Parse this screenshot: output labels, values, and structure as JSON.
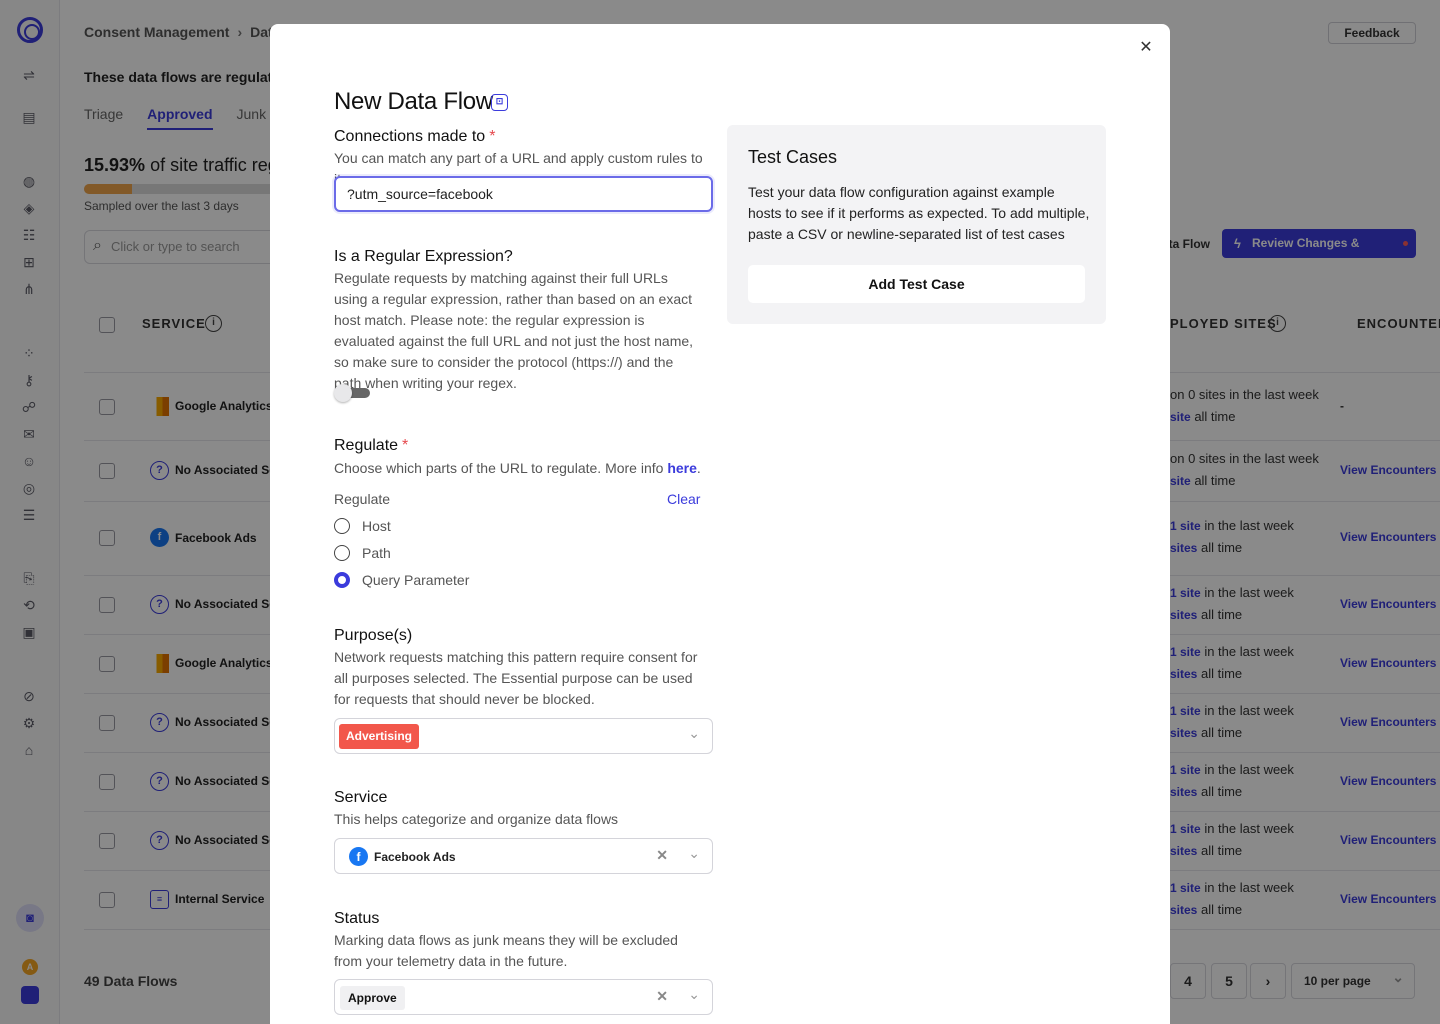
{
  "background": {
    "breadcrumb": [
      "Consent Management",
      "Data"
    ],
    "feedback_label": "Feedback",
    "regulated_note": "These data flows are regulated",
    "tabs": [
      "Triage",
      "Approved",
      "Junk"
    ],
    "traffic_pct": "15.93%",
    "traffic_text": "of site traffic regu",
    "sampled": "Sampled over the last 3 days",
    "search_placeholder": "Click or type to search",
    "new_flow_btn": "ta Flow",
    "review_btn": "Review Changes & Publish...",
    "col_service": "SERVICE",
    "col_deployed": "PLOYED SITES",
    "col_encounters": "ENCOUNTERS",
    "rows": [
      {
        "service": "Google Analytics",
        "icon": "google-analytics-icon",
        "dep1": "on 0 sites in the last week",
        "dep_link1": "",
        "dep2_link": "site",
        "dep2": "all time",
        "enc": "-"
      },
      {
        "service": "No Associated Ser",
        "icon": "question-icon",
        "dep1": "on 0 sites in the last week",
        "dep_link1": "",
        "dep2_link": "site",
        "dep2": "all time",
        "enc": "View Encounters"
      },
      {
        "service": "Facebook Ads",
        "icon": "facebook-icon",
        "dep1": "in the last week",
        "dep_link1": "1 site",
        "dep2_link": "sites",
        "dep2": "all time",
        "enc": "View Encounters"
      },
      {
        "service": "No Associated Ser",
        "icon": "question-icon",
        "dep1": "in the last week",
        "dep_link1": "1 site",
        "dep2_link": "sites",
        "dep2": "all time",
        "enc": "View Encounters"
      },
      {
        "service": "Google Analytics",
        "icon": "google-analytics-icon",
        "dep1": "in the last week",
        "dep_link1": "1 site",
        "dep2_link": "sites",
        "dep2": "all time",
        "enc": "View Encounters"
      },
      {
        "service": "No Associated Ser",
        "icon": "question-icon",
        "dep1": "in the last week",
        "dep_link1": "1 site",
        "dep2_link": "sites",
        "dep2": "all time",
        "enc": "View Encounters"
      },
      {
        "service": "No Associated Ser",
        "icon": "question-icon",
        "dep1": "in the last week",
        "dep_link1": "1 site",
        "dep2_link": "sites",
        "dep2": "all time",
        "enc": "View Encounters"
      },
      {
        "service": "No Associated Ser",
        "icon": "question-icon",
        "dep1": "in the last week",
        "dep_link1": "1 site",
        "dep2_link": "sites",
        "dep2": "all time",
        "enc": "View Encounters"
      },
      {
        "service": "Internal Service",
        "icon": "database-icon",
        "dep1": "in the last week",
        "dep_link1": "1 site",
        "dep2_link": "sites",
        "dep2": "all time",
        "enc": "View Encounters"
      }
    ],
    "count": "49 Data Flows",
    "pages": [
      "4",
      "5",
      "›"
    ],
    "per_page": "10 per page"
  },
  "modal": {
    "title": "New Data Flow",
    "connections": {
      "label": "Connections made to",
      "required": "*",
      "help": "You can match any part of a URL and apply custom rules to it",
      "value": "?utm_source=facebook"
    },
    "regex": {
      "label": "Is a Regular Expression?",
      "help": "Regulate requests by matching against their full URLs using a regular expression, rather than based on an exact host match. Please note: the regular expression is evaluated against the full URL and not just the host name, so make sure to consider the protocol (https://) and the path when writing your regex.",
      "enabled": false
    },
    "regulate": {
      "label": "Regulate",
      "required": "*",
      "help_prefix": "Choose which parts of the URL to regulate. More info ",
      "help_link": "here",
      "help_suffix": ".",
      "sublabel": "Regulate",
      "clear": "Clear",
      "options": [
        "Host",
        "Path",
        "Query Parameter"
      ],
      "selected": "Query Parameter"
    },
    "purposes": {
      "label": "Purpose(s)",
      "help": "Network requests matching this pattern require consent for all purposes selected. The Essential purpose can be used for requests that should never be blocked.",
      "selected": "Advertising",
      "chip_color": "#f2574b"
    },
    "service": {
      "label": "Service",
      "help": "This helps categorize and organize data flows",
      "value": "Facebook Ads"
    },
    "status": {
      "label": "Status",
      "help": "Marking data flows as junk means they will be excluded from your telemetry data in the future.",
      "value": "Approve"
    },
    "test_cases": {
      "title": "Test Cases",
      "desc": "Test your data flow configuration against example hosts to see if it performs as expected. To add multiple, paste a CSV or newline-separated list of test cases",
      "button": "Add Test Case"
    }
  },
  "colors": {
    "accent": "#3b3bdc",
    "required": "#e5484d",
    "overlay": "rgba(0,0,0,0.46)"
  }
}
